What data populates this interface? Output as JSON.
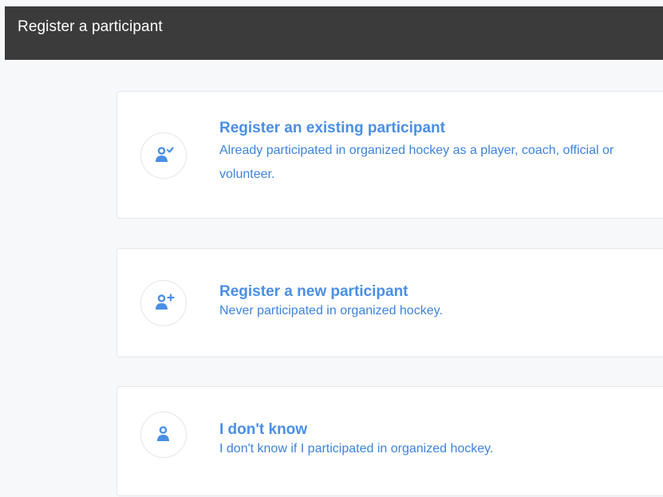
{
  "header": {
    "title": "Register a participant"
  },
  "options": [
    {
      "icon": "user-check-icon",
      "title": "Register an existing participant",
      "description": "Already participated in organized hockey as a player, coach, official or volunteer."
    },
    {
      "icon": "user-plus-icon",
      "title": "Register a new participant",
      "description": "Never participated in organized hockey."
    },
    {
      "icon": "user-icon",
      "title": "I don't know",
      "description": "I don't know if I participated in organized hockey."
    }
  ],
  "colors": {
    "header_bg": "#3b3b3b",
    "accent": "#4a8fe7"
  }
}
